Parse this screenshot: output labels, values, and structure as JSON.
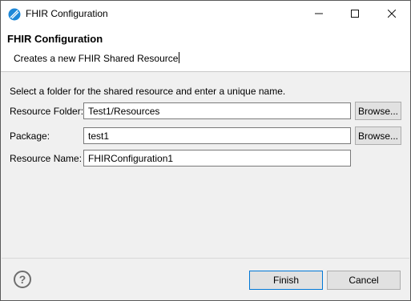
{
  "window": {
    "title": "FHIR Configuration",
    "icon": "app-logo-icon",
    "controls": {
      "minimize": "—",
      "maximize": "☐",
      "close": "✕"
    }
  },
  "header": {
    "title": "FHIR Configuration",
    "description": "Creates a new FHIR Shared Resource"
  },
  "form": {
    "instruction": "Select a folder for the shared resource and enter a unique name.",
    "resource_folder": {
      "label": "Resource Folder:",
      "value": "Test1/Resources",
      "browse": "Browse..."
    },
    "package": {
      "label": "Package:",
      "value": "test1",
      "browse": "Browse..."
    },
    "resource_name": {
      "label": "Resource Name:",
      "value": "FHIRConfiguration1"
    }
  },
  "footer": {
    "help_glyph": "?",
    "finish": "Finish",
    "cancel": "Cancel"
  },
  "colors": {
    "title_icon": "#1e88d8",
    "focus_border": "#0078d7"
  }
}
